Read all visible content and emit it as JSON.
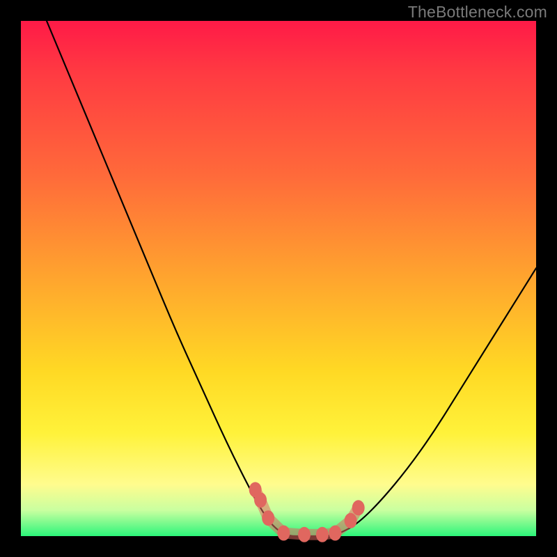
{
  "watermark": "TheBottleneck.com",
  "chart_data": {
    "type": "line",
    "title": "",
    "xlabel": "",
    "ylabel": "",
    "xlim": [
      0,
      100
    ],
    "ylim": [
      0,
      100
    ],
    "series": [
      {
        "name": "bottleneck-curve",
        "x": [
          5,
          10,
          15,
          20,
          25,
          30,
          35,
          40,
          45,
          48,
          50,
          52,
          55,
          57,
          60,
          63,
          66,
          70,
          75,
          80,
          85,
          90,
          95,
          100
        ],
        "y": [
          100,
          88,
          76,
          64,
          52,
          40,
          29,
          18,
          8,
          3,
          1,
          0,
          0,
          0,
          0,
          1,
          3,
          7,
          13,
          20,
          28,
          36,
          44,
          52
        ]
      }
    ],
    "markers": {
      "name": "highlight-points",
      "color": "#e0675f",
      "x": [
        45.5,
        46.5,
        48.0,
        51.0,
        55.0,
        58.5,
        61.0,
        64.0,
        65.5
      ],
      "y": [
        9.0,
        7.0,
        3.5,
        0.6,
        0.3,
        0.3,
        0.6,
        3.0,
        5.5
      ]
    },
    "gradient_stops": [
      {
        "pos": 0,
        "color": "#ff1a47"
      },
      {
        "pos": 30,
        "color": "#ff6a3a"
      },
      {
        "pos": 60,
        "color": "#ffd924"
      },
      {
        "pos": 90,
        "color": "#fffc8e"
      },
      {
        "pos": 100,
        "color": "#2cf57a"
      }
    ]
  }
}
